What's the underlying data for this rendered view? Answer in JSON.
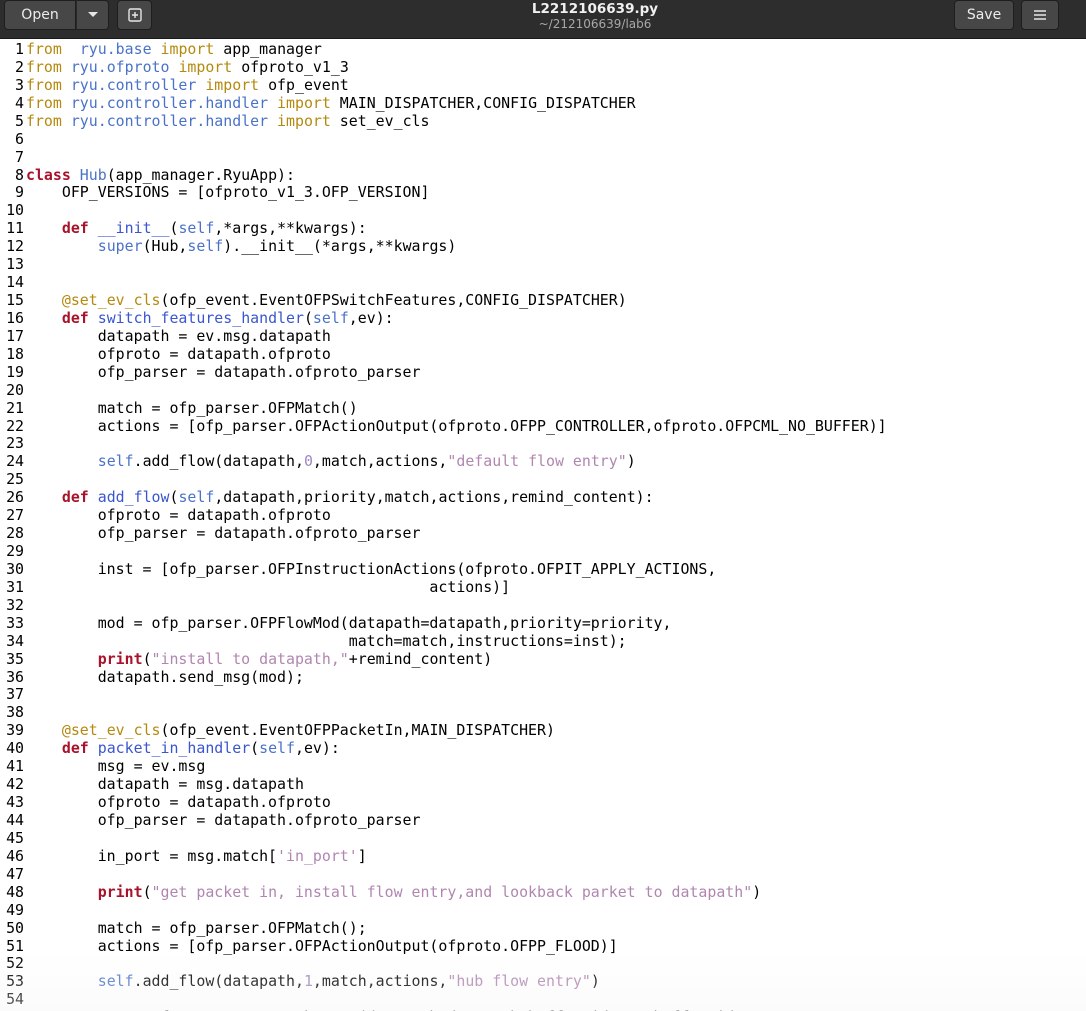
{
  "window": {
    "title": "L2212106639.py",
    "subtitle": "~/212106639/lab6",
    "open_label": "Open",
    "save_label": "Save",
    "open_dropdown_icon": "chevron-down-icon",
    "new_tab_icon": "new-document-icon",
    "menu_icon": "hamburger-menu-icon"
  },
  "editor": {
    "lines": [
      {
        "n": "1",
        "t": [
          [
            "kw",
            "from"
          ],
          [
            "",
            "  "
          ],
          [
            "bi",
            "ryu.base"
          ],
          [
            "",
            " "
          ],
          [
            "kw",
            "import"
          ],
          [
            "",
            " app_manager"
          ]
        ]
      },
      {
        "n": "2",
        "t": [
          [
            "kw",
            "from"
          ],
          [
            "",
            " "
          ],
          [
            "bi",
            "ryu.ofproto"
          ],
          [
            "",
            " "
          ],
          [
            "kw",
            "import"
          ],
          [
            "",
            " ofproto_v1_3"
          ]
        ]
      },
      {
        "n": "3",
        "t": [
          [
            "kw",
            "from"
          ],
          [
            "",
            " "
          ],
          [
            "bi",
            "ryu.controller"
          ],
          [
            "",
            " "
          ],
          [
            "kw",
            "import"
          ],
          [
            "",
            " ofp_event"
          ]
        ]
      },
      {
        "n": "4",
        "t": [
          [
            "kw",
            "from"
          ],
          [
            "",
            " "
          ],
          [
            "bi",
            "ryu.controller.handler"
          ],
          [
            "",
            " "
          ],
          [
            "kw",
            "import"
          ],
          [
            "",
            " MAIN_DISPATCHER,CONFIG_DISPATCHER"
          ]
        ]
      },
      {
        "n": "5",
        "t": [
          [
            "kw",
            "from"
          ],
          [
            "",
            " "
          ],
          [
            "bi",
            "ryu.controller.handler"
          ],
          [
            "",
            " "
          ],
          [
            "kw",
            "import"
          ],
          [
            "",
            " set_ev_cls"
          ]
        ]
      },
      {
        "n": "6",
        "t": []
      },
      {
        "n": "7",
        "t": []
      },
      {
        "n": "8",
        "t": [
          [
            "kwb",
            "class"
          ],
          [
            "",
            " "
          ],
          [
            "bi",
            "Hub"
          ],
          [
            "",
            "(app_manager.RyuApp):"
          ]
        ]
      },
      {
        "n": "9",
        "t": [
          [
            "",
            "    OFP_VERSIONS = [ofproto_v1_3.OFP_VERSION]"
          ]
        ]
      },
      {
        "n": "10",
        "t": []
      },
      {
        "n": "11",
        "t": [
          [
            "",
            "    "
          ],
          [
            "kwb",
            "def"
          ],
          [
            "",
            " "
          ],
          [
            "fn",
            "__init__"
          ],
          [
            "",
            "("
          ],
          [
            "bi",
            "self"
          ],
          [
            "",
            ",*args,**kwargs):"
          ]
        ]
      },
      {
        "n": "12",
        "t": [
          [
            "",
            "        "
          ],
          [
            "bi",
            "super"
          ],
          [
            "",
            "(Hub,"
          ],
          [
            "bi",
            "self"
          ],
          [
            "",
            ").__init__(*args,**kwargs)"
          ]
        ]
      },
      {
        "n": "13",
        "t": []
      },
      {
        "n": "14",
        "t": []
      },
      {
        "n": "15",
        "t": [
          [
            "",
            "    "
          ],
          [
            "kw",
            "@set_ev_cls"
          ],
          [
            "",
            "(ofp_event.EventOFPSwitchFeatures,CONFIG_DISPATCHER)"
          ]
        ]
      },
      {
        "n": "16",
        "t": [
          [
            "",
            "    "
          ],
          [
            "kwb",
            "def"
          ],
          [
            "",
            " "
          ],
          [
            "fn",
            "switch_features_handler"
          ],
          [
            "",
            "("
          ],
          [
            "bi",
            "self"
          ],
          [
            "",
            ",ev):"
          ]
        ]
      },
      {
        "n": "17",
        "t": [
          [
            "",
            "        datapath = ev.msg.datapath"
          ]
        ]
      },
      {
        "n": "18",
        "t": [
          [
            "",
            "        ofproto = datapath.ofproto"
          ]
        ]
      },
      {
        "n": "19",
        "t": [
          [
            "",
            "        ofp_parser = datapath.ofproto_parser"
          ]
        ]
      },
      {
        "n": "20",
        "t": []
      },
      {
        "n": "21",
        "t": [
          [
            "",
            "        match = ofp_parser.OFPMatch()"
          ]
        ]
      },
      {
        "n": "22",
        "t": [
          [
            "",
            "        actions = [ofp_parser.OFPActionOutput(ofproto.OFPP_CONTROLLER,ofproto.OFPCML_NO_BUFFER)]"
          ]
        ]
      },
      {
        "n": "23",
        "t": []
      },
      {
        "n": "24",
        "t": [
          [
            "",
            "        "
          ],
          [
            "bi",
            "self"
          ],
          [
            "",
            ".add_flow(datapath,"
          ],
          [
            "num",
            "0"
          ],
          [
            "",
            ",match,actions,"
          ],
          [
            "str",
            "\"default flow entry\""
          ],
          [
            "",
            ")"
          ]
        ]
      },
      {
        "n": "25",
        "t": []
      },
      {
        "n": "26",
        "t": [
          [
            "",
            "    "
          ],
          [
            "kwb",
            "def"
          ],
          [
            "",
            " "
          ],
          [
            "fn",
            "add_flow"
          ],
          [
            "",
            "("
          ],
          [
            "bi",
            "self"
          ],
          [
            "",
            ",datapath,priority,match,actions,remind_content):"
          ]
        ]
      },
      {
        "n": "27",
        "t": [
          [
            "",
            "        ofproto = datapath.ofproto"
          ]
        ]
      },
      {
        "n": "28",
        "t": [
          [
            "",
            "        ofp_parser = datapath.ofproto_parser"
          ]
        ]
      },
      {
        "n": "29",
        "t": []
      },
      {
        "n": "30",
        "t": [
          [
            "",
            "        inst = [ofp_parser.OFPInstructionActions(ofproto.OFPIT_APPLY_ACTIONS,"
          ]
        ]
      },
      {
        "n": "31",
        "t": [
          [
            "",
            "                                             actions)]"
          ]
        ]
      },
      {
        "n": "32",
        "t": []
      },
      {
        "n": "33",
        "t": [
          [
            "",
            "        mod = ofp_parser.OFPFlowMod(datapath=datapath,priority=priority,"
          ]
        ]
      },
      {
        "n": "34",
        "t": [
          [
            "",
            "                                    match=match,instructions=inst);"
          ]
        ]
      },
      {
        "n": "35",
        "t": [
          [
            "",
            "        "
          ],
          [
            "kwb",
            "print"
          ],
          [
            "",
            "("
          ],
          [
            "str",
            "\"install to datapath,\""
          ],
          [
            "",
            "+remind_content)"
          ]
        ]
      },
      {
        "n": "36",
        "t": [
          [
            "",
            "        datapath.send_msg(mod);"
          ]
        ]
      },
      {
        "n": "37",
        "t": []
      },
      {
        "n": "38",
        "t": []
      },
      {
        "n": "39",
        "t": [
          [
            "",
            "    "
          ],
          [
            "kw",
            "@set_ev_cls"
          ],
          [
            "",
            "(ofp_event.EventOFPPacketIn,MAIN_DISPATCHER)"
          ]
        ]
      },
      {
        "n": "40",
        "t": [
          [
            "",
            "    "
          ],
          [
            "kwb",
            "def"
          ],
          [
            "",
            " "
          ],
          [
            "fn",
            "packet_in_handler"
          ],
          [
            "",
            "("
          ],
          [
            "bi",
            "self"
          ],
          [
            "",
            ",ev):"
          ]
        ]
      },
      {
        "n": "41",
        "t": [
          [
            "",
            "        msg = ev.msg"
          ]
        ]
      },
      {
        "n": "42",
        "t": [
          [
            "",
            "        datapath = msg.datapath"
          ]
        ]
      },
      {
        "n": "43",
        "t": [
          [
            "",
            "        ofproto = datapath.ofproto"
          ]
        ]
      },
      {
        "n": "44",
        "t": [
          [
            "",
            "        ofp_parser = datapath.ofproto_parser"
          ]
        ]
      },
      {
        "n": "45",
        "t": []
      },
      {
        "n": "46",
        "t": [
          [
            "",
            "        in_port = msg.match["
          ],
          [
            "str",
            "'in_port'"
          ],
          [
            "",
            "]"
          ]
        ]
      },
      {
        "n": "47",
        "t": []
      },
      {
        "n": "48",
        "t": [
          [
            "",
            "        "
          ],
          [
            "kwb",
            "print"
          ],
          [
            "",
            "("
          ],
          [
            "str",
            "\"get packet in, install flow entry,and lookback parket to datapath\""
          ],
          [
            "",
            ")"
          ]
        ]
      },
      {
        "n": "49",
        "t": []
      },
      {
        "n": "50",
        "t": [
          [
            "",
            "        match = ofp_parser.OFPMatch();"
          ]
        ]
      },
      {
        "n": "51",
        "t": [
          [
            "",
            "        actions = [ofp_parser.OFPActionOutput(ofproto.OFPP_FLOOD)]"
          ]
        ]
      },
      {
        "n": "52",
        "t": []
      },
      {
        "n": "53",
        "t": [
          [
            "",
            "        "
          ],
          [
            "bi",
            "self"
          ],
          [
            "",
            ".add_flow(datapath,"
          ],
          [
            "num",
            "1"
          ],
          [
            "",
            ",match,actions,"
          ],
          [
            "str",
            "\"hub flow entry\""
          ],
          [
            "",
            ")"
          ]
        ]
      },
      {
        "n": "54",
        "t": []
      },
      {
        "n": "55",
        "t": [
          [
            "",
            "        out = ofp_parser.OFPPacketOut(datapath=datapath,buffer_id=msg.buffer_id,"
          ]
        ]
      }
    ]
  }
}
